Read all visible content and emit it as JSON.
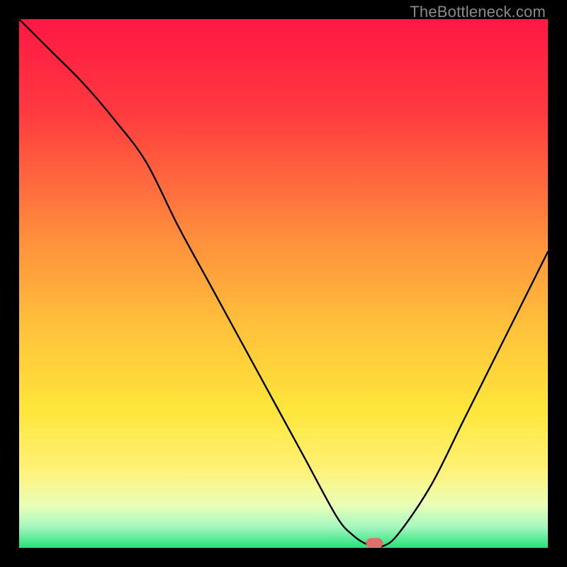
{
  "watermark": "TheBottleneck.com",
  "chart_data": {
    "type": "line",
    "title": "",
    "xlabel": "",
    "ylabel": "",
    "xlim": [
      0,
      100
    ],
    "ylim": [
      0,
      100
    ],
    "x": [
      0,
      6,
      12,
      18,
      24,
      30,
      36,
      42,
      48,
      54,
      60,
      63,
      66,
      69,
      72,
      78,
      84,
      90,
      96,
      100
    ],
    "values": [
      100,
      94,
      88,
      81,
      73,
      61,
      50,
      39,
      28,
      17,
      6,
      2.5,
      0.6,
      0.4,
      3,
      12,
      24,
      36,
      48,
      56
    ],
    "marker": {
      "x": 67.2,
      "y": 0.9,
      "color": "#e06e6e",
      "w": 3.2,
      "h": 1.9
    },
    "gradient_stops": [
      {
        "offset": 0,
        "color": "#ff1744"
      },
      {
        "offset": 18,
        "color": "#ff3b3f"
      },
      {
        "offset": 40,
        "color": "#ff8a3d"
      },
      {
        "offset": 58,
        "color": "#ffc13b"
      },
      {
        "offset": 74,
        "color": "#ffe63b"
      },
      {
        "offset": 85,
        "color": "#fff176"
      },
      {
        "offset": 92,
        "color": "#e9ffb8"
      },
      {
        "offset": 96,
        "color": "#a6f7c0"
      },
      {
        "offset": 100,
        "color": "#24e27a"
      }
    ]
  }
}
